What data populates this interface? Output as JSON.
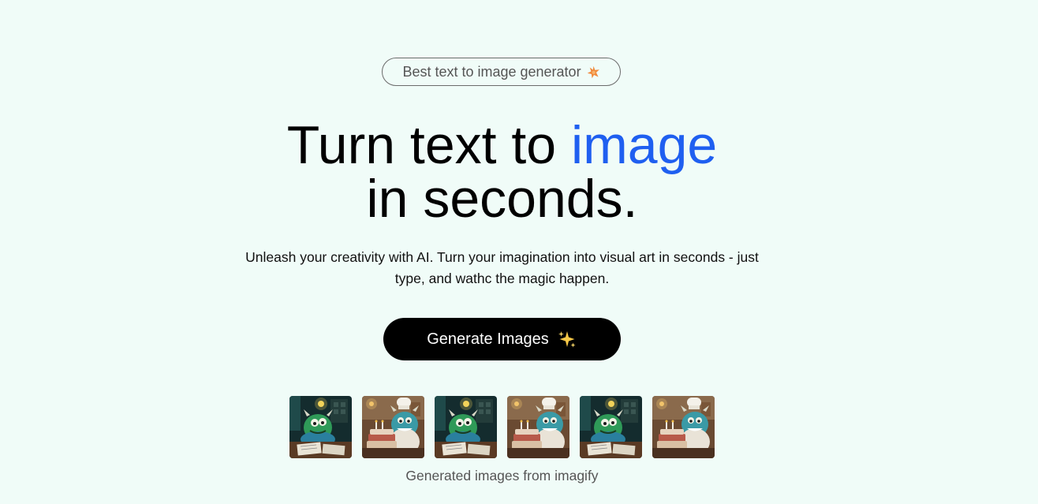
{
  "badge": {
    "label": "Best text to image generator",
    "icon": "star-icon",
    "icon_color": "#f08a3c"
  },
  "headline": {
    "part1": "Turn text to ",
    "accent": "image",
    "part2": "in seconds.",
    "accent_color": "#1f5ff0"
  },
  "subtext": "Unleash your creativity with AI. Turn your imagination into visual art in seconds - just type, and wathc the magic happen.",
  "cta": {
    "label": "Generate Images",
    "icon": "sparkles-icon"
  },
  "gallery": {
    "images": [
      {
        "subject": "green-monster-writing"
      },
      {
        "subject": "monster-chef-cake"
      },
      {
        "subject": "green-monster-writing"
      },
      {
        "subject": "monster-chef-cake"
      },
      {
        "subject": "green-monster-writing"
      },
      {
        "subject": "monster-chef-cake"
      }
    ],
    "caption": "Generated images from imagify"
  }
}
